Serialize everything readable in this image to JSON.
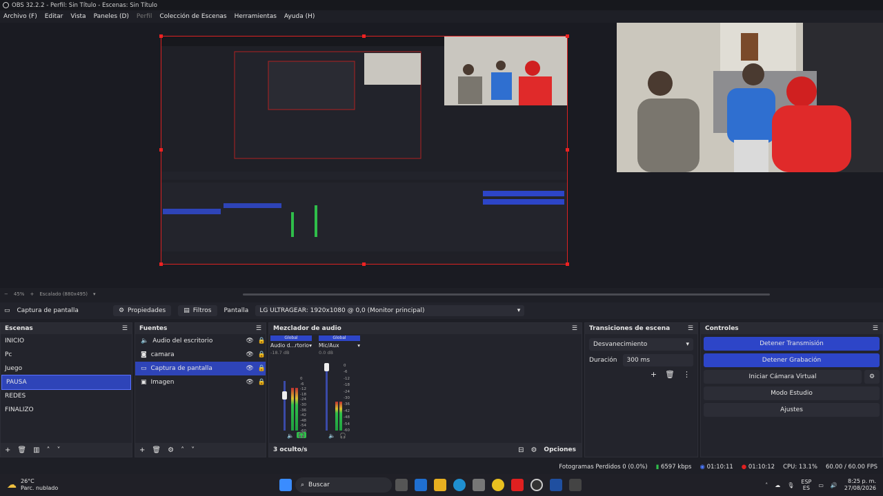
{
  "window": {
    "title": "OBS 32.2.2 - Perfil: Sin Título - Escenas: Sin Título"
  },
  "menu": [
    "Archivo (F)",
    "Editar",
    "Vista",
    "Paneles (D)",
    "Perfil",
    "Colección de Escenas",
    "Herramientas",
    "Ayuda (H)"
  ],
  "preview_bar": {
    "zoom": "45%",
    "scaling": "Escalado (880x495)"
  },
  "source_toolbar": {
    "source_name": "Captura de pantalla",
    "properties": "Propiedades",
    "filters": "Filtros",
    "screen_label": "Pantalla",
    "screen_value": "LG ULTRAGEAR: 1920x1080 @ 0,0 (Monitor principal)"
  },
  "scenes": {
    "title": "Escenas",
    "items": [
      "INICIO",
      "Pc",
      "Juego",
      "PAUSA",
      "REDES",
      "FINALIZO"
    ],
    "selected": "PAUSA"
  },
  "sources": {
    "title": "Fuentes",
    "items": [
      {
        "label": "Audio del escritorio",
        "icon": "speaker-icon"
      },
      {
        "label": "camara",
        "icon": "camera-icon"
      },
      {
        "label": "Captura de pantalla",
        "icon": "monitor-icon"
      },
      {
        "label": "Imagen",
        "icon": "image-icon"
      }
    ],
    "selected": "Captura de pantalla"
  },
  "mixer": {
    "title": "Mezclador de audio",
    "channels": [
      {
        "tag": "Global",
        "name": "Audio d...rtorio",
        "db": "-18.7 dB",
        "level": 0.45
      },
      {
        "tag": "Global",
        "name": "Mic/Aux",
        "db": "0.0 dB",
        "level": 0.7
      }
    ],
    "scale": [
      "0",
      "-6",
      "-12",
      "-18",
      "-24",
      "-30",
      "-36",
      "-42",
      "-48",
      "-54",
      "-60"
    ],
    "hidden": "3 oculto/s",
    "options": "Opciones"
  },
  "transitions": {
    "title": "Transiciones de escena",
    "type": "Desvanecimiento",
    "duration_label": "Duración",
    "duration": "300 ms"
  },
  "controls": {
    "title": "Controles",
    "stop_stream": "Detener Transmisión",
    "stop_record": "Detener Grabación",
    "virtual_cam": "Iniciar Cámara Virtual",
    "studio_mode": "Modo Estudio",
    "settings": "Ajustes"
  },
  "status": {
    "dropped": "Fotogramas Perdidos 0 (0.0%)",
    "bitrate": "6597 kbps",
    "stream_time": "01:10:11",
    "rec_time": "01:10:12",
    "cpu": "CPU: 13.1%",
    "fps": "60.00 / 60.00 FPS"
  },
  "taskbar": {
    "weather_temp": "26°C",
    "weather_desc": "Parc. nublado",
    "search": "Buscar",
    "lang_top": "ESP",
    "lang_bottom": "ES",
    "time": "8:25 p. m.",
    "date": "27/08/2026"
  },
  "colors": {
    "accent": "#2d45c8",
    "selection_outline": "#e22222",
    "bg": "#1e1f26"
  }
}
